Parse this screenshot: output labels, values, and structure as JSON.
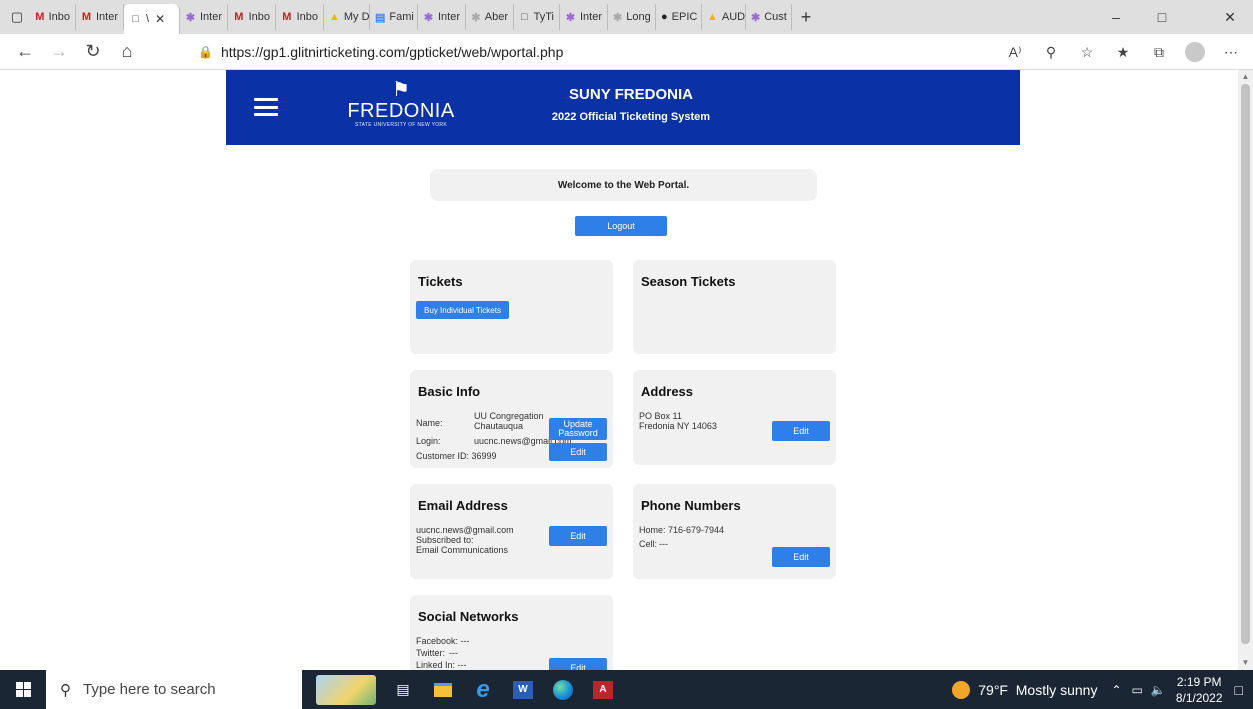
{
  "browser": {
    "tabs": [
      {
        "label": "Inbo",
        "icon": "gmail-icon"
      },
      {
        "label": "Inter",
        "icon": "gmail-icon"
      },
      {
        "label": "\\",
        "icon": "page-icon",
        "active": true
      },
      {
        "label": "Inter",
        "icon": "purple-site-icon"
      },
      {
        "label": "Inbo",
        "icon": "gmail-icon"
      },
      {
        "label": "Inbo",
        "icon": "gmail-icon"
      },
      {
        "label": "My D",
        "icon": "drive-icon"
      },
      {
        "label": "Fami",
        "icon": "docs-icon"
      },
      {
        "label": "Inter",
        "icon": "purple-site-icon"
      },
      {
        "label": "Aber",
        "icon": "faded-site-icon"
      },
      {
        "label": "TyTi",
        "icon": "page-icon"
      },
      {
        "label": "Inter",
        "icon": "purple-site-icon"
      },
      {
        "label": "Long",
        "icon": "faded-site-icon"
      },
      {
        "label": "EPIC",
        "icon": "epic-icon"
      },
      {
        "label": "AUD",
        "icon": "drive-icon"
      },
      {
        "label": "Cust",
        "icon": "purple-site-icon"
      }
    ],
    "url": "https://gp1.glitnirticketing.com/gpticket/web/wportal.php",
    "colors": {
      "gmail": "#c5221f",
      "drive": "#f4b400",
      "docs": "#4285f4",
      "purple": "#9a6bd4"
    }
  },
  "site": {
    "logo_word": "FREDONIA",
    "logo_sub": "STATE UNIVERSITY OF NEW YORK",
    "title": "SUNY FREDONIA",
    "subtitle": "2022 Official Ticketing System",
    "header_color": "#0a31a6",
    "button_color": "#2f7fe8"
  },
  "portal": {
    "welcome": "Welcome to the Web Portal.",
    "logout_label": "Logout",
    "tickets": {
      "title": "Tickets",
      "buy_label": "Buy Individual Tickets"
    },
    "season": {
      "title": "Season Tickets"
    },
    "basic": {
      "title": "Basic Info",
      "name_label": "Name:",
      "name_line1": "UU Congregation",
      "name_line2": "Chautauqua",
      "login_label": "Login:",
      "login_value": "uucnc.news@gmail.com",
      "customer_line": "Customer ID: 36999",
      "update_line1": "Update",
      "update_line2": "Password",
      "edit_label": "Edit"
    },
    "address": {
      "title": "Address",
      "line1": "PO Box 11",
      "line2": "Fredonia NY 14063",
      "edit_label": "Edit"
    },
    "email": {
      "title": "Email Address",
      "address": "uucnc.news@gmail.com",
      "subscribed": "Subscribed to:",
      "list": "Email Communications",
      "edit_label": "Edit"
    },
    "phone": {
      "title": "Phone Numbers",
      "home": "Home: 716-679-7944",
      "cell_label": "Cell:",
      "cell_value": "---",
      "edit_label": "Edit"
    },
    "social": {
      "title": "Social Networks",
      "facebook": "Facebook: ---",
      "twitter_label": "Twitter:",
      "twitter_value": "---",
      "linkedin": "Linked In: ---",
      "edit_label": "Edit"
    }
  },
  "taskbar": {
    "search_placeholder": "Type here to search",
    "weather": "79°F  Mostly sunny",
    "time": "2:19 PM",
    "date": "8/1/2022"
  }
}
